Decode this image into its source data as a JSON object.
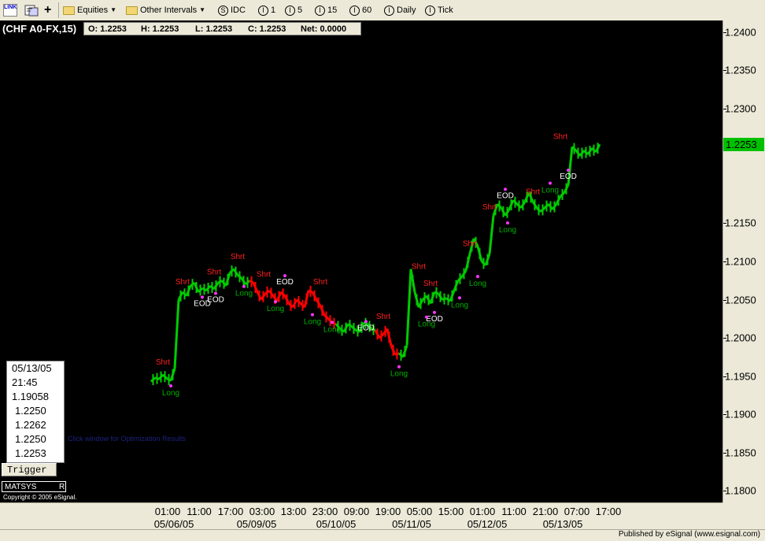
{
  "toolbar": {
    "link_label": "LINK",
    "equities_label": "Equities",
    "other_intervals_label": "Other Intervals",
    "idc_label": "IDC",
    "interval_1": "1",
    "interval_5": "5",
    "interval_15": "15",
    "interval_60": "60",
    "interval_daily": "Daily",
    "interval_tick": "Tick"
  },
  "chart_header": {
    "symbol": "(CHF A0-FX,15)",
    "open": "O:  1.2253",
    "high": "H:  1.2253",
    "low": "L:  1.2253",
    "close": "C:  1.2253",
    "net": "Net:  0.0000"
  },
  "cursor_box": {
    "date": "05/13/05",
    "time": "21:45",
    "v1": "1.19058",
    "v2": "1.2250",
    "v3": "1.2262",
    "v4": "1.2250",
    "v5": "1.2253"
  },
  "hint_text": "Click window for Optimization Results",
  "trigger_label": "Trigger",
  "matsys_label": "MATSYS",
  "matsys_flag": "R",
  "copyright": "Copyright © 2005 eSignal.",
  "publisher": "Published by eSignal (www.esignal.com)",
  "colors": {
    "up": "#00cc00",
    "down": "#ff0000",
    "short_label": "#ff2020",
    "long_label": "#00b000",
    "eod_label": "#ffffff",
    "marker": "#ff33ff",
    "last_price_bg": "#00c000"
  },
  "chart_data": {
    "type": "line",
    "yaxis": {
      "ticks": [
        "1.2400",
        "1.2350",
        "1.2300",
        "1.2150",
        "1.2100",
        "1.2050",
        "1.2000",
        "1.1950",
        "1.1900",
        "1.1850",
        "1.1800"
      ],
      "ylim": [
        1.1785,
        1.2415
      ],
      "last_price": "1.2253"
    },
    "xaxis": {
      "time_labels": [
        "01:00",
        "11:00",
        "17:00",
        "03:00",
        "13:00",
        "23:00",
        "09:00",
        "19:00",
        "05:00",
        "15:00",
        "01:00",
        "11:00",
        "21:00",
        "07:00",
        "17:00"
      ],
      "date_labels": [
        "05/06/05",
        "05/09/05",
        "05/10/05",
        "05/11/05",
        "05/12/05",
        "05/13/05"
      ]
    },
    "series": [
      {
        "x": [
          0,
          5,
          10,
          15,
          20,
          25,
          30,
          35,
          40,
          45,
          50,
          55,
          60,
          65,
          70,
          75,
          80,
          85,
          90,
          95,
          100,
          105,
          110,
          115,
          120,
          125,
          130,
          135,
          140,
          145,
          150,
          155,
          160,
          165,
          170,
          175,
          180,
          185,
          190,
          195,
          200,
          205,
          210,
          215,
          220,
          225,
          230,
          235,
          240,
          245,
          250,
          255,
          260,
          265,
          270,
          275,
          280,
          285,
          290,
          295,
          300,
          305,
          310,
          315,
          320,
          325,
          330,
          335,
          340,
          345,
          350,
          355,
          360,
          365,
          370,
          375,
          380,
          385,
          390,
          395,
          400,
          405,
          410,
          415,
          420,
          425,
          430,
          435,
          440,
          445,
          450,
          455,
          460,
          465,
          470,
          475,
          480,
          485,
          490,
          495,
          500,
          505,
          510,
          515,
          520,
          525,
          530,
          535,
          540,
          545,
          550,
          555,
          560,
          565,
          570
        ],
        "y": [
          1.1943,
          1.1948,
          1.1946,
          1.1952,
          1.1947,
          1.1944,
          1.196,
          1.205,
          1.206,
          1.2055,
          1.2068,
          1.2072,
          1.206,
          1.2065,
          1.2062,
          1.2068,
          1.2064,
          1.2072,
          1.2075,
          1.2068,
          1.2085,
          1.209,
          1.2082,
          1.2078,
          1.207,
          1.2075,
          1.2072,
          1.206,
          1.205,
          1.2058,
          1.2062,
          1.2055,
          1.2048,
          1.206,
          1.2055,
          1.2045,
          1.204,
          1.205,
          1.2045,
          1.204,
          1.2062,
          1.206,
          1.205,
          1.2042,
          1.203,
          1.2025,
          1.202,
          1.2018,
          1.2012,
          1.2008,
          1.2018,
          1.2015,
          1.201,
          1.2008,
          1.202,
          1.2018,
          1.2012,
          1.201,
          1.2,
          1.2005,
          1.2012,
          1.199,
          1.1978,
          1.198,
          1.1975,
          1.199,
          1.209,
          1.206,
          1.204,
          1.205,
          1.2055,
          1.2045,
          1.206,
          1.2058,
          1.205,
          1.2052,
          1.2048,
          1.2062,
          1.2075,
          1.208,
          1.2088,
          1.211,
          1.213,
          1.212,
          1.21,
          1.2095,
          1.211,
          1.216,
          1.2175,
          1.217,
          1.216,
          1.2168,
          1.218,
          1.2175,
          1.217,
          1.2178,
          1.219,
          1.2178,
          1.217,
          1.2165,
          1.217,
          1.2175,
          1.2168,
          1.2175,
          1.2185,
          1.219,
          1.22,
          1.225,
          1.2245,
          1.2238,
          1.2245,
          1.224,
          1.2248,
          1.2243,
          1.2253
        ]
      }
    ],
    "signals": [
      {
        "label": "Shrt",
        "x": 15,
        "y": 1.1965
      },
      {
        "label": "Long",
        "x": 25,
        "y": 1.1925
      },
      {
        "label": "Shrt",
        "x": 40,
        "y": 1.207
      },
      {
        "label": "EOD",
        "x": 65,
        "y": 1.2042
      },
      {
        "label": "Shrt",
        "x": 80,
        "y": 1.2083
      },
      {
        "label": "EOD",
        "x": 82,
        "y": 1.2047
      },
      {
        "label": "Shrt",
        "x": 110,
        "y": 1.2103
      },
      {
        "label": "Long",
        "x": 118,
        "y": 1.2055
      },
      {
        "label": "Shrt",
        "x": 143,
        "y": 1.208
      },
      {
        "label": "EOD",
        "x": 170,
        "y": 1.207
      },
      {
        "label": "Long",
        "x": 158,
        "y": 1.2035
      },
      {
        "label": "Shrt",
        "x": 215,
        "y": 1.207
      },
      {
        "label": "Long",
        "x": 205,
        "y": 1.2018
      },
      {
        "label": "Long",
        "x": 230,
        "y": 1.2008
      },
      {
        "label": "EOD",
        "x": 273,
        "y": 1.201
      },
      {
        "label": "Shrt",
        "x": 295,
        "y": 1.2025
      },
      {
        "label": "Long",
        "x": 315,
        "y": 1.195
      },
      {
        "label": "Shrt",
        "x": 340,
        "y": 1.209
      },
      {
        "label": "Shrt",
        "x": 355,
        "y": 1.2068
      },
      {
        "label": "EOD",
        "x": 360,
        "y": 1.2022
      },
      {
        "label": "Long",
        "x": 350,
        "y": 1.2015
      },
      {
        "label": "Long",
        "x": 392,
        "y": 1.204
      },
      {
        "label": "Shrt",
        "x": 405,
        "y": 1.212
      },
      {
        "label": "Long",
        "x": 415,
        "y": 1.2068
      },
      {
        "label": "Shrt",
        "x": 430,
        "y": 1.2168
      },
      {
        "label": "EOD",
        "x": 450,
        "y": 1.2183
      },
      {
        "label": "Long",
        "x": 453,
        "y": 1.2138
      },
      {
        "label": "Shrt",
        "x": 485,
        "y": 1.2188
      },
      {
        "label": "Long",
        "x": 507,
        "y": 1.219
      },
      {
        "label": "Shrt",
        "x": 520,
        "y": 1.226
      },
      {
        "label": "EOD",
        "x": 530,
        "y": 1.2208
      }
    ]
  }
}
